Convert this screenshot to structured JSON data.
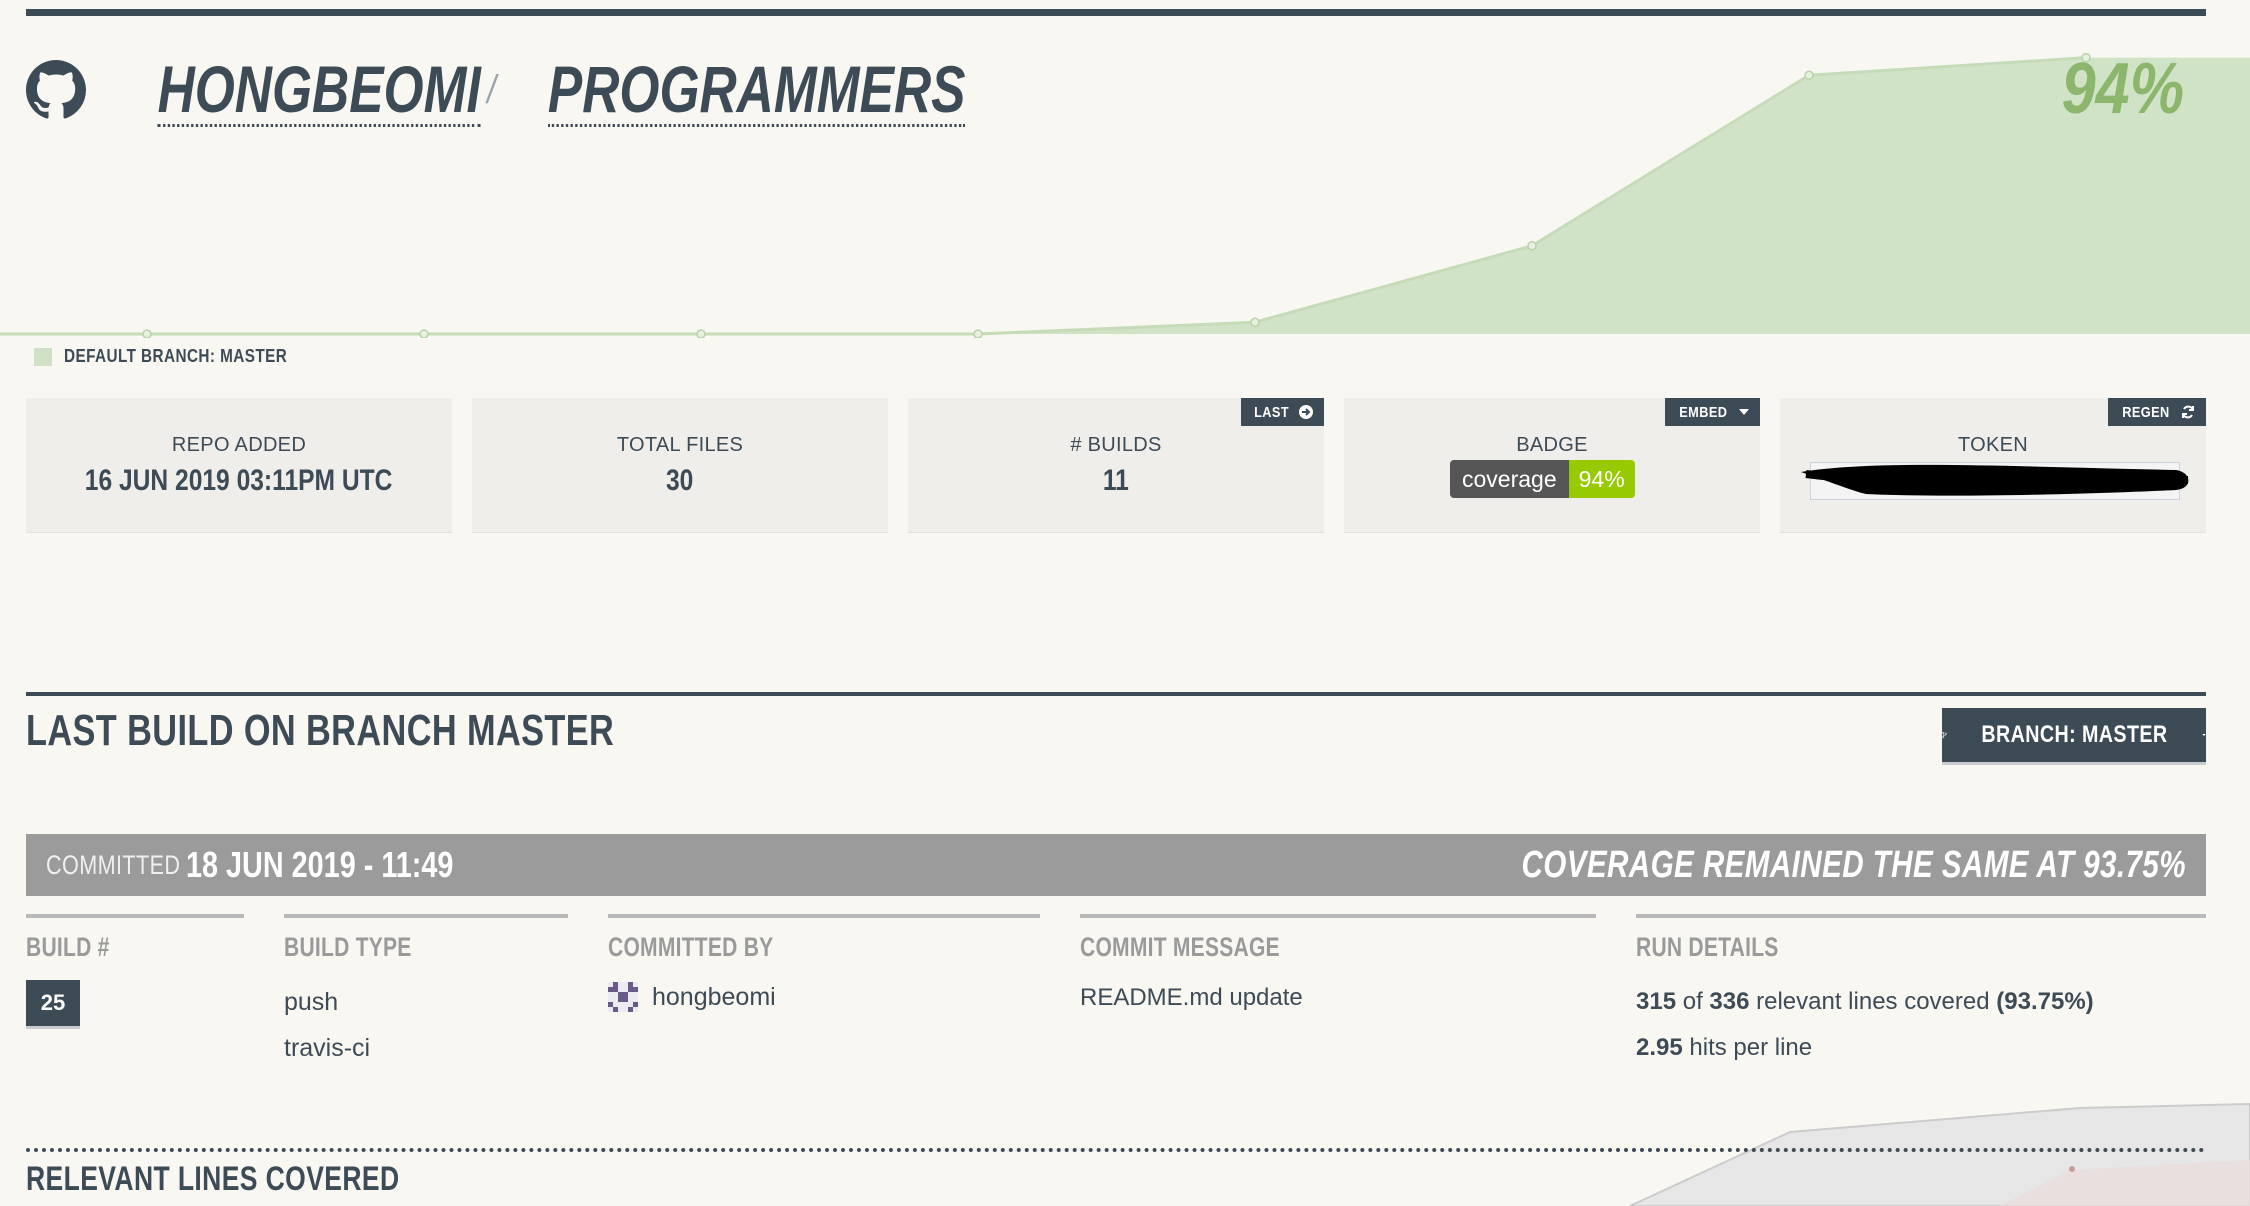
{
  "repo": {
    "owner": "HONGBEOMI",
    "separator": "/",
    "name": "PROGRAMMERS",
    "coverage": "94%"
  },
  "chart_data": {
    "type": "area",
    "title": "",
    "xlabel": "",
    "ylabel": "",
    "x": [
      1,
      2,
      3,
      4,
      5,
      6,
      7,
      8,
      9
    ],
    "series": [
      {
        "name": "",
        "values": [
          0,
          0,
          0,
          0,
          0,
          4,
          30,
          88,
          94
        ]
      }
    ],
    "ylim": [
      0,
      100
    ],
    "grid": false,
    "colors": {
      "fill": "#d1e3c7",
      "line": "#c6dcb9"
    }
  },
  "legend": {
    "label": "DEFAULT BRANCH: MASTER"
  },
  "stats": {
    "repo_added": {
      "label": "REPO ADDED",
      "value": "16 JUN 2019 03:11PM UTC"
    },
    "total_files": {
      "label": "TOTAL FILES",
      "value": "30"
    },
    "builds": {
      "label": "# BUILDS",
      "value": "11",
      "button": "LAST"
    },
    "badge": {
      "label": "BADGE",
      "button": "EMBED",
      "left": "coverage",
      "right": "94%"
    },
    "token": {
      "label": "TOKEN",
      "button": "REGEN"
    }
  },
  "last_build": {
    "title": "LAST BUILD ON BRANCH MASTER",
    "branch_button": "BRANCH: MASTER",
    "committed_label": "COMMITTED",
    "committed_date": "18 JUN 2019 - 11:49",
    "coverage_status": "COVERAGE REMAINED THE SAME AT 93.75%",
    "columns": {
      "build": {
        "head": "BUILD #",
        "value": "25"
      },
      "build_type": {
        "head": "BUILD TYPE",
        "values": [
          "push",
          "travis-ci"
        ]
      },
      "committed_by": {
        "head": "COMMITTED BY",
        "user": "hongbeomi"
      },
      "commit_message": {
        "head": "COMMIT MESSAGE",
        "text": "README.md update"
      },
      "run_details": {
        "head": "RUN DETAILS",
        "covered": "315",
        "of": "of",
        "relevant": "336",
        "relevant_text": "relevant lines covered",
        "pct": "(93.75%)",
        "hits": "2.95",
        "hits_text": "hits per line"
      }
    }
  },
  "relevant_lines": {
    "title": "RELEVANT LINES COVERED"
  },
  "colors": {
    "brand": "#3d4b57",
    "accent": "#8bb66c",
    "badge_green": "#97ca00",
    "commit_bar": "#9b9b9b"
  }
}
